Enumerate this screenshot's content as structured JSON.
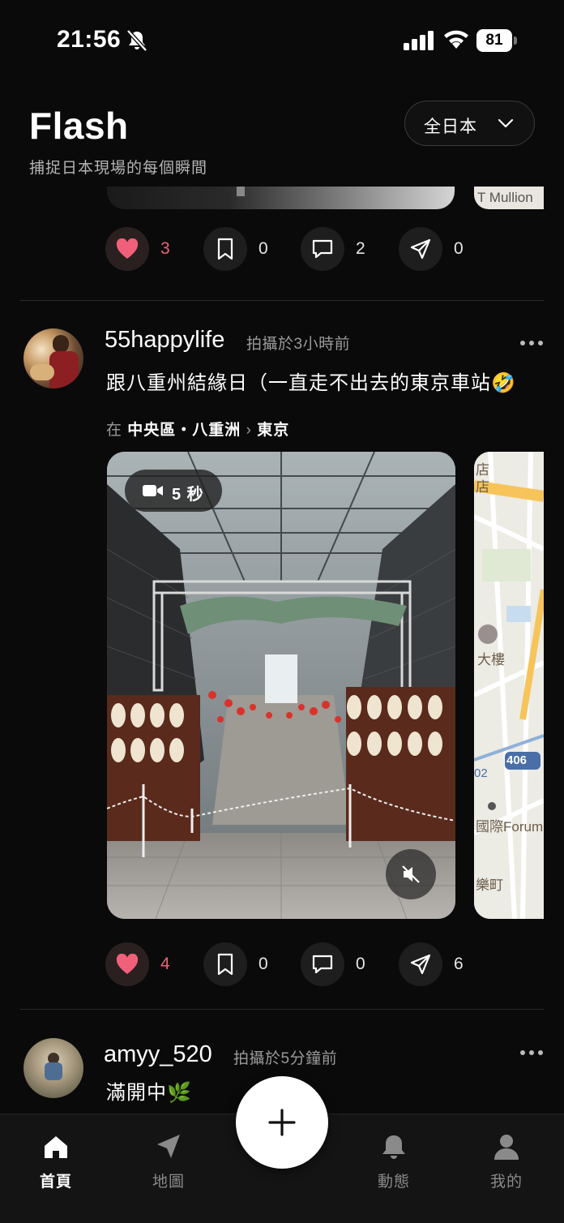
{
  "status": {
    "time": "21:56",
    "battery": "81"
  },
  "header": {
    "title": "Flash",
    "subtitle": "捕捉日本現場的每個瞬間",
    "region": "全日本"
  },
  "post1": {
    "map_text": "T Mullion",
    "likes": "3",
    "saves": "0",
    "comments": "2",
    "shares": "0"
  },
  "post2": {
    "username": "55happylife",
    "time": "拍攝於3小時前",
    "text": "跟八重州結緣日（一直走不出去的東京車站🤣",
    "location_prefix": "在",
    "location": "中央區・八重洲",
    "location_city": "東京",
    "video_duration": "5 秒",
    "map_labels": [
      "店",
      "店",
      "大樓",
      "406",
      "02",
      "國際Forum",
      "樂町"
    ],
    "likes": "4",
    "saves": "0",
    "comments": "0",
    "shares": "6"
  },
  "post3": {
    "username": "amyy_520",
    "time": "拍攝於5分鐘前",
    "text": "滿開中🌿"
  },
  "nav": {
    "home": "首頁",
    "map": "地圖",
    "activity": "動態",
    "me": "我的"
  },
  "colors": {
    "like": "#f0607a",
    "background": "#0a0a0a"
  }
}
